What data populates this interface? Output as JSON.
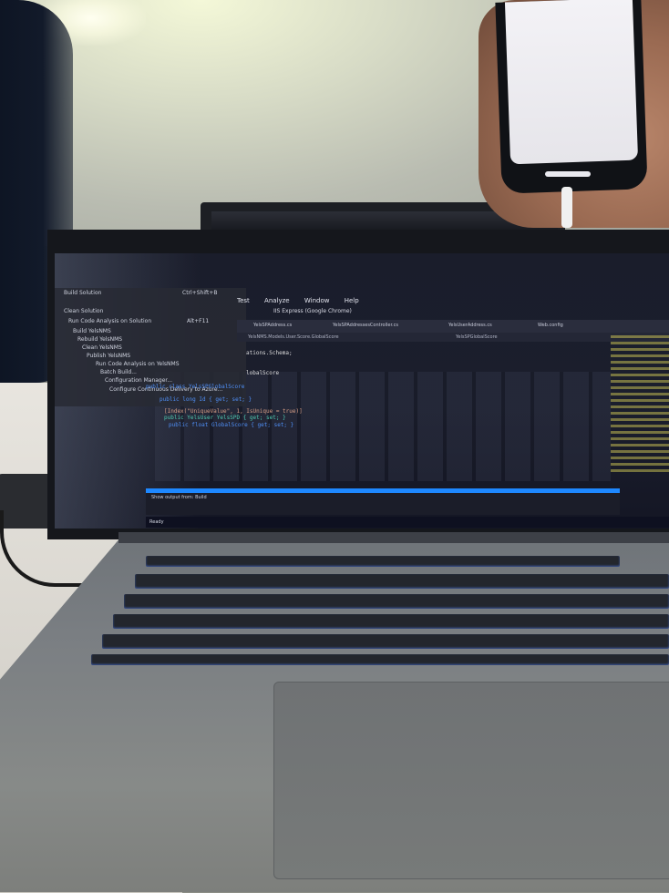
{
  "screen": {
    "menu": {
      "items": [
        "Build Solution",
        "Ctrl+Shift+B",
        "Clean Solution",
        "Run Code Analysis on Solution",
        "Alt+F11",
        "Build YelsNMS",
        "Rebuild YelsNMS",
        "Clean YelsNMS",
        "Publish YelsNMS",
        "Run Code Analysis on YelsNMS",
        "Batch Build...",
        "Configuration Manager...",
        "Configure Continuous Delivery to Azure..."
      ]
    },
    "menubar": [
      "Test",
      "Analyze",
      "Window",
      "Help"
    ],
    "toolbar_run": "IIS Express (Google Chrome)",
    "tabs": [
      "YelsSPAddress.cs",
      "YelsSPAddressesController.cs",
      "YelsUserAddress.cs",
      "Web.config"
    ],
    "path": "YelsNMS.Models.User.Score.GlobalScore",
    "path_member": "YelsSPGlobalScore",
    "code": [
      "ations.Schema;",
      "lobalScore",
      "public class YelsSPGlobalScore",
      "public long Id { get; set; }",
      "[Index(\"UniqueValue\", 1, IsUnique = true)]",
      "public YelsUser YelsSPD { get; set; }",
      "public float GlobalScore { get; set; }"
    ],
    "output_title": "Show output from: Build",
    "taskbar_text": "Ready"
  },
  "colors": {
    "accent": "#1e88ff",
    "keyword": "#4f8ff7",
    "type": "#4ec9b0",
    "string": "#d69d85",
    "text": "#dcdcdc"
  }
}
